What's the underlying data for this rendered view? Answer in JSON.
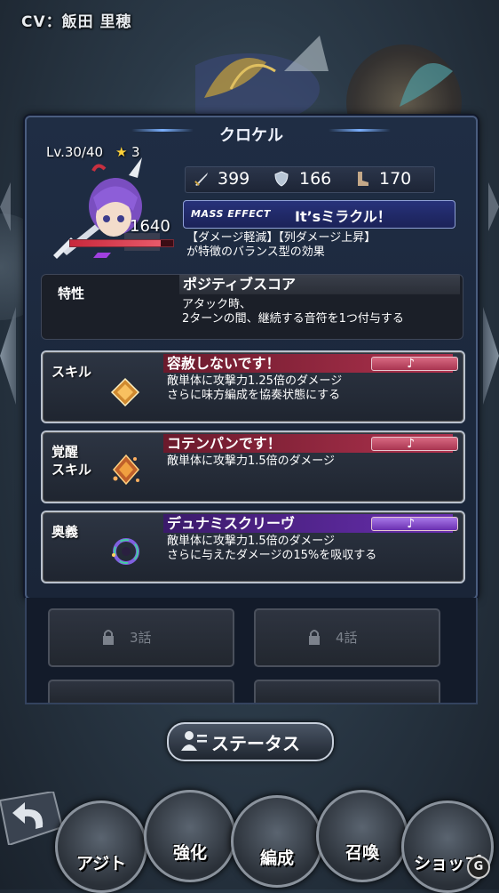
{
  "cv_label": "CV：飯田 里穂",
  "character": {
    "name": "クロケル",
    "level": "Lv.30/40",
    "rank": "3",
    "power": "1640",
    "hp_fraction": 0.88
  },
  "stats": [
    {
      "icon": "sword-icon",
      "value": "399"
    },
    {
      "icon": "shield-icon",
      "value": "166"
    },
    {
      "icon": "boot-icon",
      "value": "170"
    }
  ],
  "mass_effect": {
    "label": "MASS EFFECT",
    "name": "It’sミラクル！",
    "description": "【ダメージ軽減】【列ダメージ上昇】\nが特徴のバランス型の効果"
  },
  "trait": {
    "label": "特性",
    "title": "ポジティブスコア",
    "description": "アタック時、\n2ターンの間、継続する音符を1つ付与する"
  },
  "skills": [
    {
      "label": "スキル",
      "title": "容赦しないです！",
      "description": "敵単体に攻撃力1.25倍のダメージ\nさらに味方編成を協奏状態にする",
      "note": "♪",
      "color": "#b0324e"
    },
    {
      "label": "覚醒\nスキル",
      "title": "コテンパンです！",
      "description": "敵単体に攻撃力1.5倍のダメージ",
      "note": "♪",
      "color": "#b0324e"
    },
    {
      "label": "奥義",
      "title": "デュナミスクリーヴ",
      "description": "敵単体に攻撃力1.5倍のダメージ\nさらに与えたダメージの15%を吸収する",
      "note": "♪",
      "color": "#6a2fb0"
    }
  ],
  "episodes": [
    {
      "label": "3話"
    },
    {
      "label": "4話"
    }
  ],
  "status_button": "ステータス",
  "nav": [
    {
      "label": "アジト"
    },
    {
      "label": "強化"
    },
    {
      "label": "編成"
    },
    {
      "label": "召喚"
    },
    {
      "label": "ショップ"
    }
  ],
  "colors": {
    "panel_border": "#4a5d7f",
    "star": "#ffd23a",
    "mass_effect_bg": "#27327a"
  }
}
